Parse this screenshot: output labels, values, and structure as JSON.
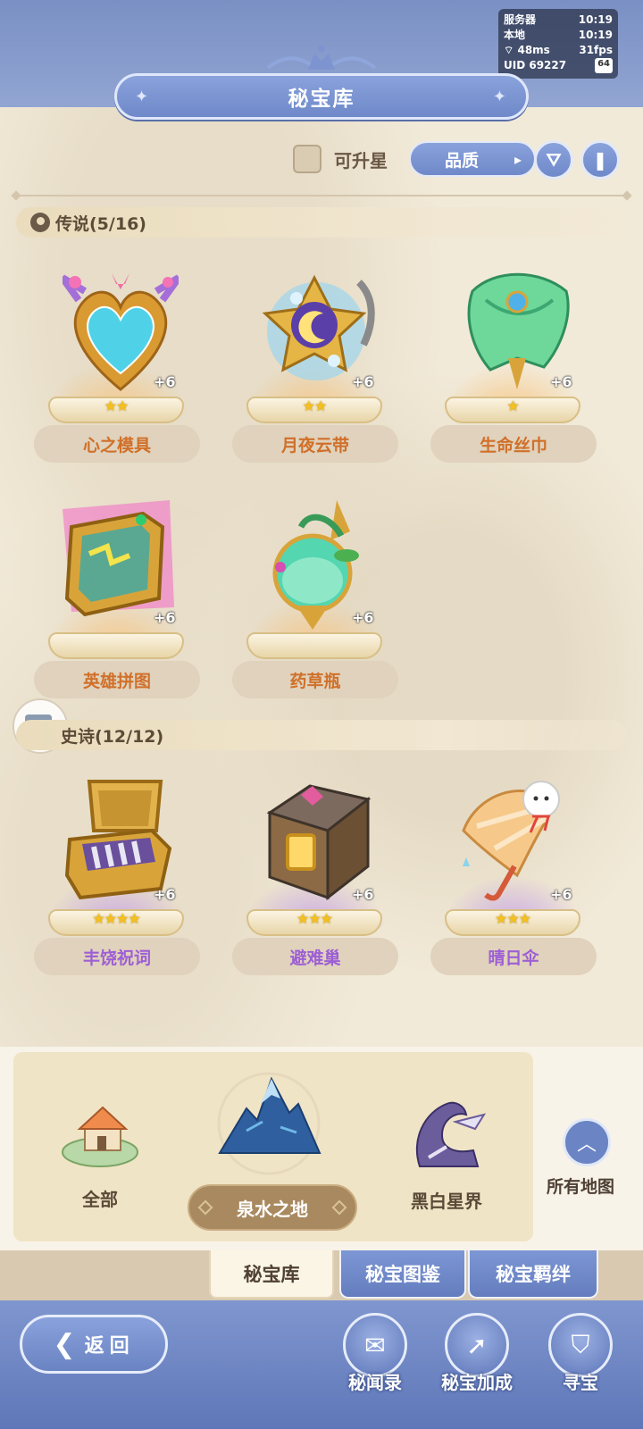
{
  "status": {
    "server_label": "服务器",
    "server_time": "10:19",
    "local_label": "本地",
    "local_time": "10:19",
    "ping": "48ms",
    "fps": "31fps",
    "uid": "UID 69227",
    "battery": "64"
  },
  "header": {
    "title": "秘宝库"
  },
  "filters": {
    "upgradable_label": "可升星",
    "sort_label": "品质"
  },
  "sections": [
    {
      "title": "传说(5/16)",
      "items": [
        {
          "name": "心之模具",
          "level": "+6",
          "stars": "★★"
        },
        {
          "name": "月夜云带",
          "level": "+6",
          "stars": "★★"
        },
        {
          "name": "生命丝巾",
          "level": "+6",
          "stars": "★"
        },
        {
          "name": "英雄拼图",
          "level": "+6",
          "stars": ""
        },
        {
          "name": "药草瓶",
          "level": "+6",
          "stars": ""
        }
      ]
    },
    {
      "title": "史诗(12/12)",
      "items": [
        {
          "name": "丰饶祝词",
          "level": "+6",
          "stars": "★★★★"
        },
        {
          "name": "避难巢",
          "level": "+6",
          "stars": "★★★"
        },
        {
          "name": "晴日伞",
          "level": "+6",
          "stars": "★★★"
        }
      ]
    }
  ],
  "maps": {
    "items": [
      "全部",
      "泉水之地",
      "黑白星界"
    ],
    "selected": "泉水之地",
    "all_maps_label": "所有地图"
  },
  "tabs": [
    "秘宝库",
    "秘宝图鉴",
    "秘宝羁绊"
  ],
  "bottom": {
    "back_label": "返回",
    "actions": [
      "秘闻录",
      "秘宝加成",
      "寻宝"
    ]
  },
  "colors": {
    "accent_blue": "#6f89c9",
    "legendary_name": "#d0702a",
    "epic_name": "#9d5fd4"
  }
}
